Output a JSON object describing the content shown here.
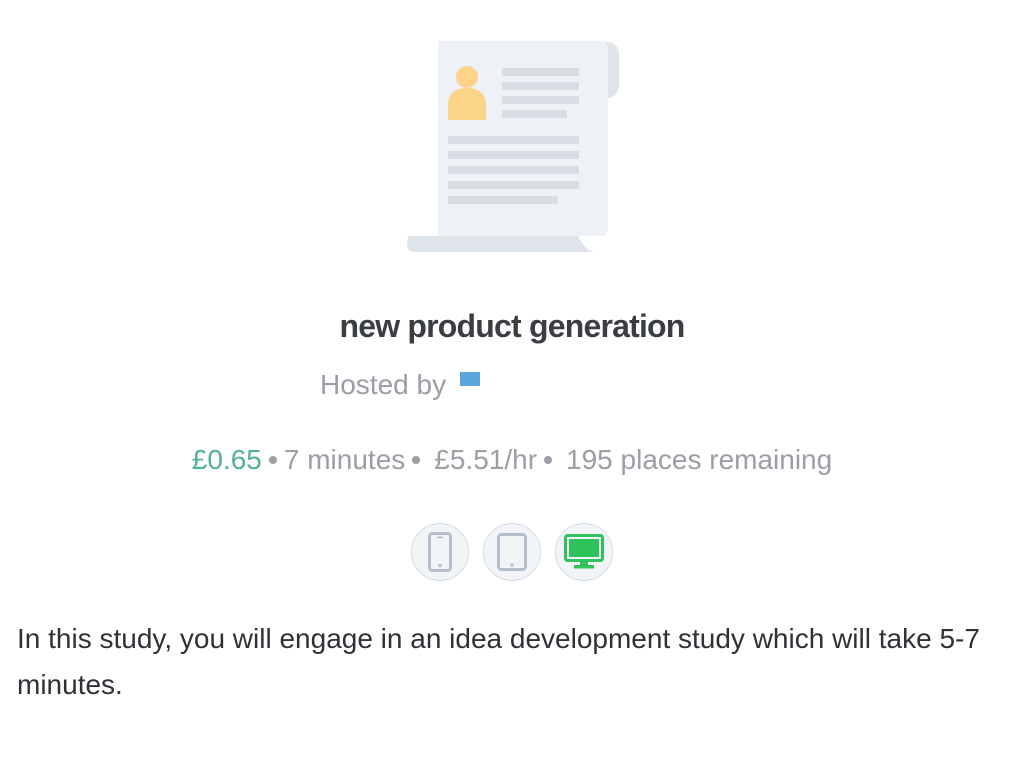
{
  "study": {
    "title": "new product generation",
    "hosted_by_label": "Hosted by",
    "reward": "£0.65",
    "duration": "7 minutes",
    "hourly_rate": "£5.51/hr",
    "places_remaining": "195 places remaining",
    "description": "In this study, you will engage in an idea development study which will take 5-7 minutes."
  },
  "devices": [
    {
      "name": "mobile",
      "icon": "smartphone-icon",
      "allowed": false
    },
    {
      "name": "tablet",
      "icon": "tablet-icon",
      "allowed": false
    },
    {
      "name": "desktop",
      "icon": "desktop-icon",
      "allowed": true
    }
  ],
  "colors": {
    "reward": "#52b48d",
    "device_allowed": "#2fc25b",
    "device_disallowed": "#b6c0cc",
    "host_logo": "#5aa7dc"
  }
}
